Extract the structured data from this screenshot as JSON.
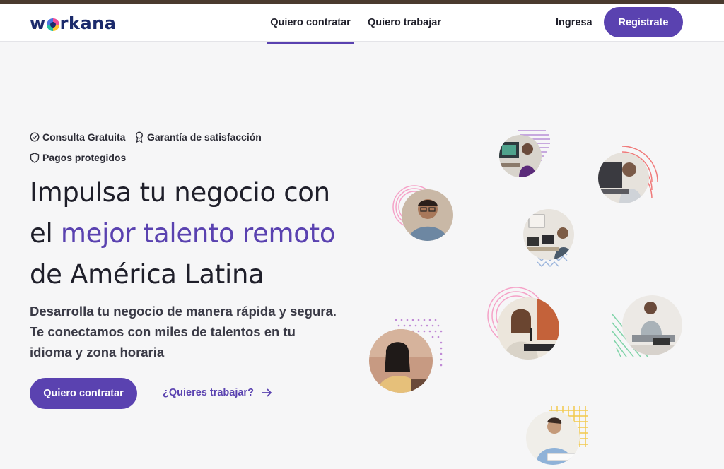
{
  "brand": {
    "name_pre": "w",
    "name_post": "rkana"
  },
  "nav": {
    "hire": "Quiero contratar",
    "work": "Quiero trabajar",
    "login": "Ingresa",
    "register": "Registrate"
  },
  "badges": {
    "free": "Consulta Gratuita",
    "satisfaction": "Garantía de satisfacción",
    "payments": "Pagos protegidos"
  },
  "hero": {
    "line1": "Impulsa tu negocio con",
    "line2_pre": "el ",
    "line2_highlight": "mejor talento remoto",
    "line3": "de América Latina",
    "subtitle_1": "Desarrolla tu negocio de manera rápida y segura.",
    "subtitle_2": "Te conectamos con miles de talentos en tu",
    "subtitle_3": "idioma y zona horaria",
    "cta_hire": "Quiero contratar",
    "cta_work": "¿Quieres trabajar?"
  },
  "colors": {
    "accent": "#5a42b0",
    "brand_navy": "#1b2a6b",
    "background": "#f6f6f7"
  },
  "icons": [
    "check-circle-icon",
    "award-icon",
    "shield-icon",
    "arrow-right-icon"
  ]
}
